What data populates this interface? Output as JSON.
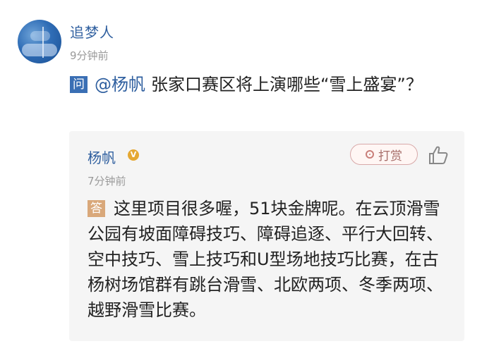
{
  "asker": {
    "name": "追梦人",
    "time": "9分钟前"
  },
  "question": {
    "badge": "问",
    "mention": "@杨帆",
    "text": "张家口赛区将上演哪些“雪上盛宴”？"
  },
  "answer": {
    "author": "杨帆",
    "verified_badge": "V",
    "reward_label": "打赏",
    "time": "7分钟前",
    "badge": "答",
    "text": "这里项目很多喔，51块金牌呢。在云顶滑雪公园有坡面障碍技巧、障碍追逐、平行大回转、空中技巧、雪上技巧和U型场地技巧比赛，在古杨树场馆群有跳台滑雪、北欧两项、冬季两项、越野滑雪比赛。"
  },
  "icons": {
    "reward": "reward-icon",
    "like": "thumbs-up-icon",
    "avatar": "user-avatar"
  },
  "colors": {
    "link": "#2f5f9f",
    "question_badge": "#3a6fb4",
    "answer_badge": "#d9a87a",
    "reward": "#a76e6a"
  }
}
